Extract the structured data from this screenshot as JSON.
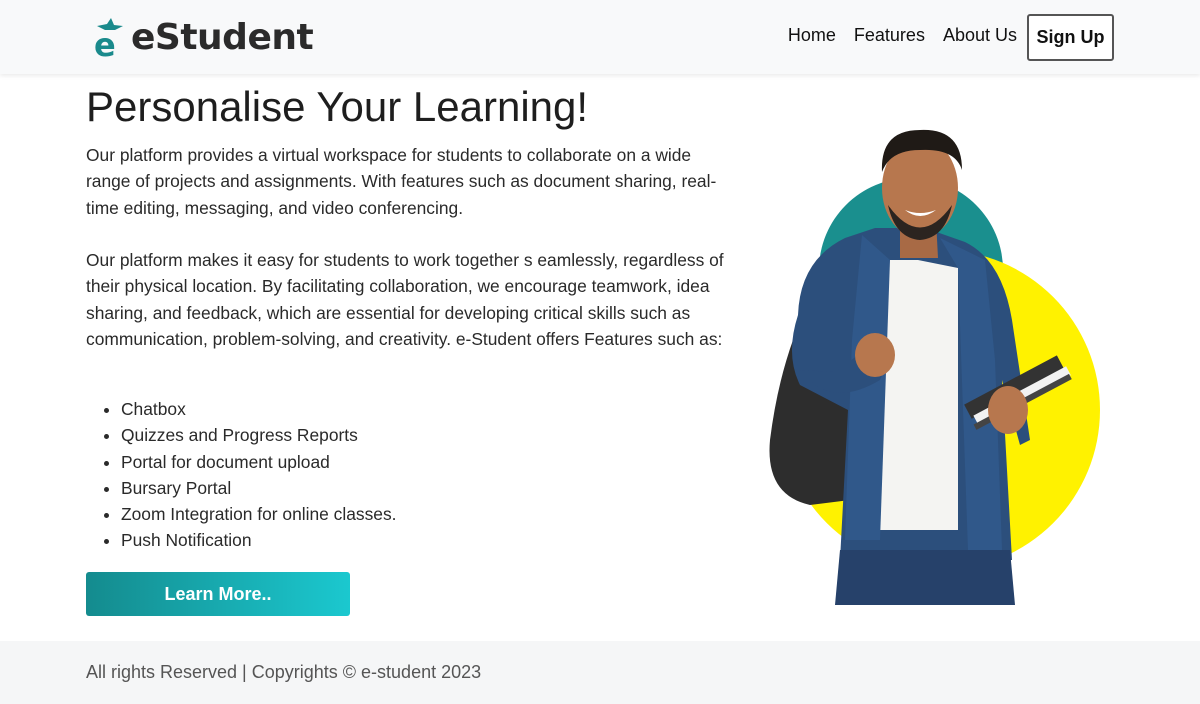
{
  "brand": {
    "name": "eStudent",
    "accent_color": "#1a8a8c"
  },
  "nav": {
    "links": [
      "Home",
      "Features",
      "About Us"
    ],
    "signup_label": "Sign Up"
  },
  "hero": {
    "title": "Personalise Your Learning!",
    "paragraphs": [
      "Our platform provides a virtual workspace for students to collaborate on a wide range of projects and assignments. With features such as document sharing, real-time editing, messaging, and video conferencing.",
      "Our platform makes it easy for students to work together s eamlessly, regardless of their physical location. By facilitating collaboration, we encourage teamwork, idea sharing, and feedback, which are essential for developing critical skills such as communication, problem-solving, and creativity. e-Student offers Features such as:"
    ],
    "features": [
      "Chatbox",
      "Quizzes and Progress Reports",
      "Portal for document upload",
      "Bursary Portal",
      "Zoom Integration for online classes.",
      "Push Notification"
    ],
    "cta_label": "Learn More..",
    "cta_gradient": [
      "#148b8e",
      "#1bc8cf"
    ],
    "illustration_colors": {
      "teal_circle": "#1a8f8e",
      "yellow_circle": "#fff200"
    }
  },
  "footer": {
    "text": "All rights Reserved | Copyrights © e-student 2023"
  }
}
